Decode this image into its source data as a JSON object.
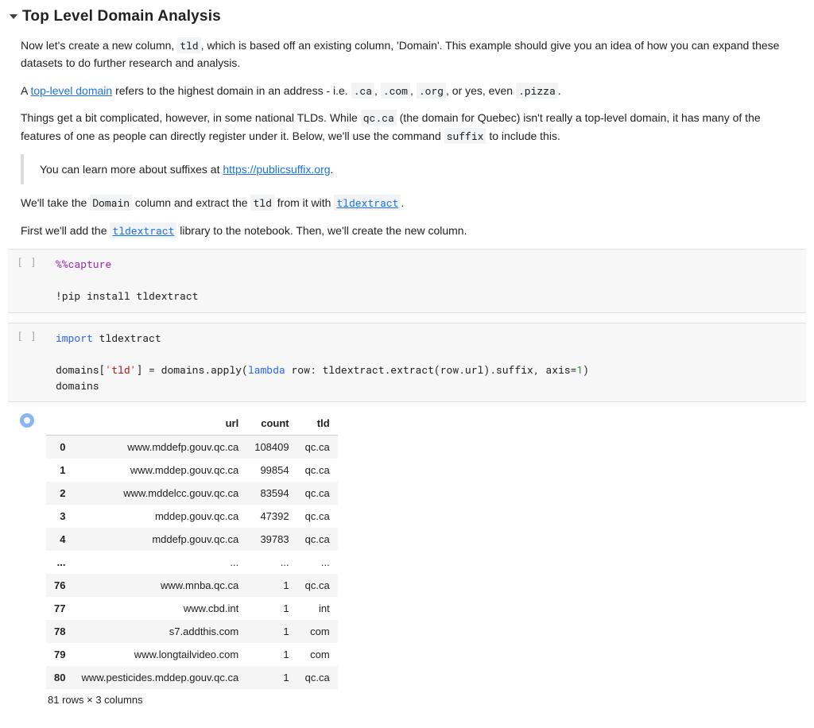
{
  "section": {
    "title": "Top Level Domain Analysis",
    "p1_a": "Now let's create a new column, ",
    "p1_code": "tld",
    "p1_b": ", which is based off an existing column, 'Domain'. This example should give you an idea of how you can expand these datasets to do further research and analysis.",
    "p2_a": "A ",
    "p2_link": "top-level domain",
    "p2_b": " refers to the highest domain in an address - i.e. ",
    "p2_code1": ".ca",
    "p2_mid1": ", ",
    "p2_code2": ".com",
    "p2_mid2": ", ",
    "p2_code3": ".org",
    "p2_mid3": ", or yes, even ",
    "p2_code4": ".pizza",
    "p2_end": ".",
    "p3_a": "Things get a bit complicated, however, in some national TLDs. While ",
    "p3_code1": "qc.ca",
    "p3_b": " (the domain for Quebec) isn't really a top-level domain, it has many of the features of one as people can directly register under it. Below, we'll use the command ",
    "p3_code2": "suffix",
    "p3_c": " to include this.",
    "note_a": "You can learn more about suffixes at ",
    "note_link": "https://publicsuffix.org",
    "note_end": ".",
    "p4_a": "We'll take the ",
    "p4_code1": "Domain",
    "p4_b": " column and extract the ",
    "p4_code2": "tld",
    "p4_c": " from it with ",
    "p4_link": "tldextract",
    "p4_end": ".",
    "p5_a": "First we'll add the ",
    "p5_link": "tldextract",
    "p5_b": " library to the notebook. Then, we'll create the new column."
  },
  "cells": {
    "prompt_empty": "[ ]",
    "cell1": {
      "magic": "%%capture",
      "bang": "!",
      "shell": "pip install tldextract"
    },
    "cell2": {
      "kw_import": "import",
      "mod": " tldextract",
      "line2a": "domains[",
      "line2_str": "'tld'",
      "line2b": "] = domains.apply(",
      "kw_lambda": "lambda",
      "line2c": " row: tldextract.extract(row.url).suffix, axis=",
      "num1": "1",
      "line2d": ")",
      "line3": "domains"
    }
  },
  "df": {
    "headers": {
      "idx": "",
      "url": "url",
      "count": "count",
      "tld": "tld"
    },
    "rows": [
      {
        "idx": "0",
        "url": "www.mddefp.gouv.qc.ca",
        "count": "108409",
        "tld": "qc.ca"
      },
      {
        "idx": "1",
        "url": "www.mddep.gouv.qc.ca",
        "count": "99854",
        "tld": "qc.ca"
      },
      {
        "idx": "2",
        "url": "www.mddelcc.gouv.qc.ca",
        "count": "83594",
        "tld": "qc.ca"
      },
      {
        "idx": "3",
        "url": "mddep.gouv.qc.ca",
        "count": "47392",
        "tld": "qc.ca"
      },
      {
        "idx": "4",
        "url": "mddefp.gouv.qc.ca",
        "count": "39783",
        "tld": "qc.ca"
      },
      {
        "idx": "...",
        "url": "...",
        "count": "...",
        "tld": "..."
      },
      {
        "idx": "76",
        "url": "www.mnba.qc.ca",
        "count": "1",
        "tld": "qc.ca"
      },
      {
        "idx": "77",
        "url": "www.cbd.int",
        "count": "1",
        "tld": "int"
      },
      {
        "idx": "78",
        "url": "s7.addthis.com",
        "count": "1",
        "tld": "com"
      },
      {
        "idx": "79",
        "url": "www.longtailvideo.com",
        "count": "1",
        "tld": "com"
      },
      {
        "idx": "80",
        "url": "www.pesticides.mddep.gouv.qc.ca",
        "count": "1",
        "tld": "qc.ca"
      }
    ],
    "footer": "81 rows × 3 columns"
  }
}
